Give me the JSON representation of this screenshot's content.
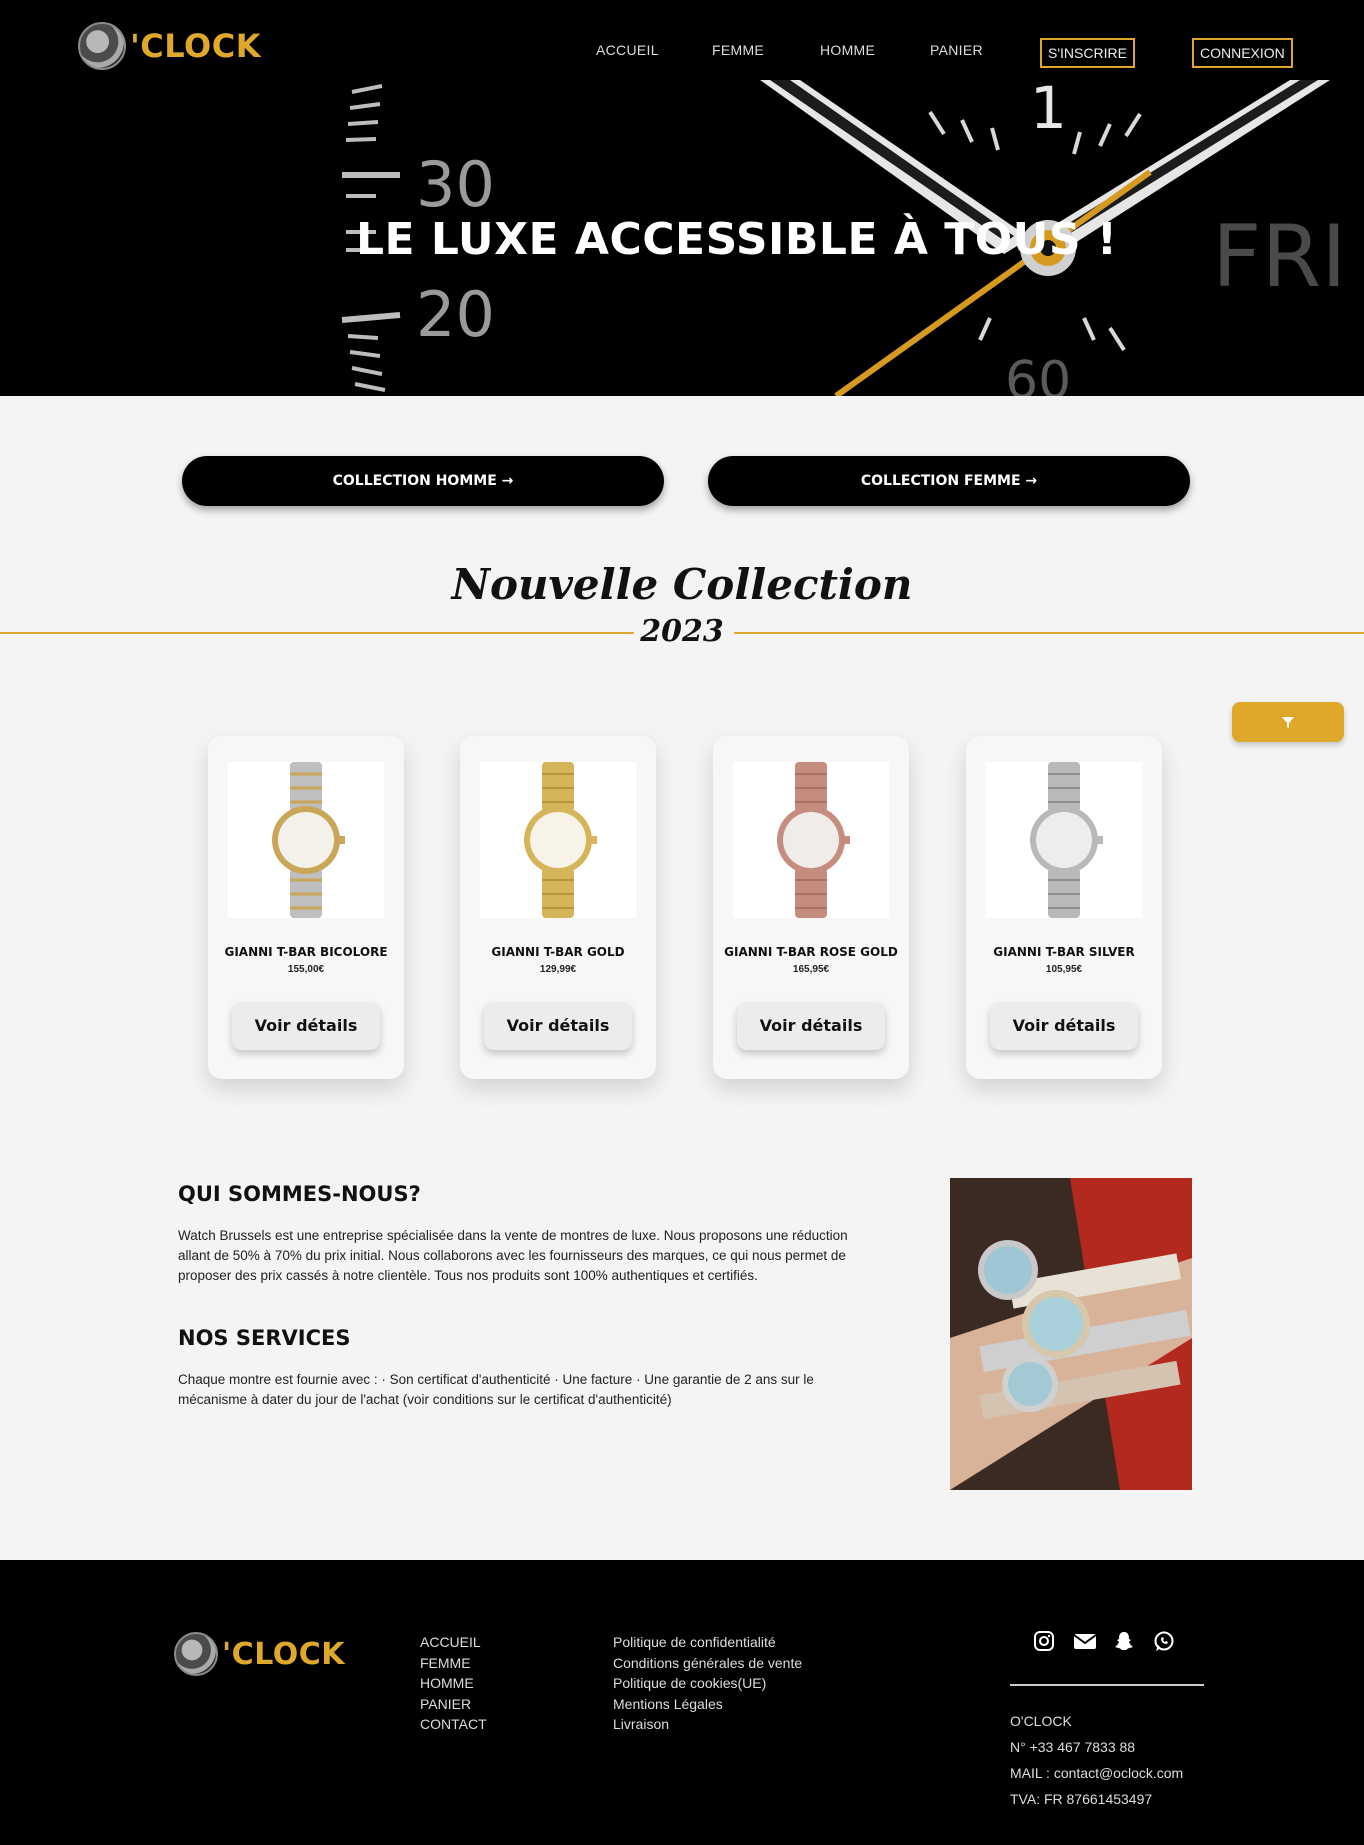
{
  "header": {
    "logo_text": "'CLOCK",
    "nav": [
      "ACCUEIL",
      "FEMME",
      "HOMME",
      "PANIER"
    ],
    "signup_label": "S'INSCRIRE",
    "login_label": "CONNEXION"
  },
  "hero": {
    "title": "LE LUXE ACCESSIBLE À TOUS !",
    "dial_numbers": [
      "30",
      "20",
      "1",
      "60"
    ],
    "dial_day": "FRI"
  },
  "collections": {
    "men_label": "COLLECTION HOMME →",
    "women_label": "COLLECTION FEMME →"
  },
  "new_collection": {
    "title": "Nouvelle Collection",
    "year": "2023",
    "filter_icon": "filter-icon"
  },
  "products": [
    {
      "name": "GIANNI T-BAR BICOLORE",
      "price": "155,00€",
      "button": "Voir détails",
      "metal": "#c9a65a",
      "band": "#bfbfbf"
    },
    {
      "name": "GIANNI T-BAR GOLD",
      "price": "129,99€",
      "button": "Voir détails",
      "metal": "#d6b45a",
      "band": "#d6b45a"
    },
    {
      "name": "GIANNI T-BAR ROSE GOLD",
      "price": "165,95€",
      "button": "Voir détails",
      "metal": "#c48d7f",
      "band": "#c48d7f"
    },
    {
      "name": "GIANNI T-BAR SILVER",
      "price": "105,95€",
      "button": "Voir détails",
      "metal": "#b9b9b9",
      "band": "#b9b9b9"
    }
  ],
  "about": {
    "heading": "QUI SOMMES-NOUS?",
    "text": "Watch Brussels est une entreprise spécialisée dans la vente de montres de luxe. Nous proposons une réduction allant de 50% à 70% du prix initial. Nous collaborons avec les fournisseurs des marques, ce qui nous permet de proposer des prix cassés à notre clientèle. Tous nos produits sont 100% authentiques et certifiés.",
    "services_heading": "NOS SERVICES",
    "services_text": "Chaque montre est fournie avec : · Son certificat d'authenticité · Une facture · Une garantie de 2 ans sur le mécanisme à dater du jour de l'achat (voir conditions sur le certificat d'authenticité)"
  },
  "footer": {
    "logo_text": "'CLOCK",
    "nav": [
      "ACCUEIL",
      "FEMME",
      "HOMME",
      "PANIER",
      "CONTACT"
    ],
    "legal": [
      "Politique de confidentialité",
      "Conditions générales de vente",
      "Politique de cookies(UE)",
      "Mentions Légales",
      "Livraison"
    ],
    "social": [
      "instagram-icon",
      "mail-icon",
      "snapchat-icon",
      "whatsapp-icon"
    ],
    "contact": [
      "O'CLOCK",
      "N° +33 467 7833 88",
      "MAIL : contact@oclock.com",
      "TVA: FR 87661453497"
    ]
  },
  "colors": {
    "accent": "#e0a82a",
    "dark": "#000000",
    "page_bg": "#f4f4f4"
  }
}
